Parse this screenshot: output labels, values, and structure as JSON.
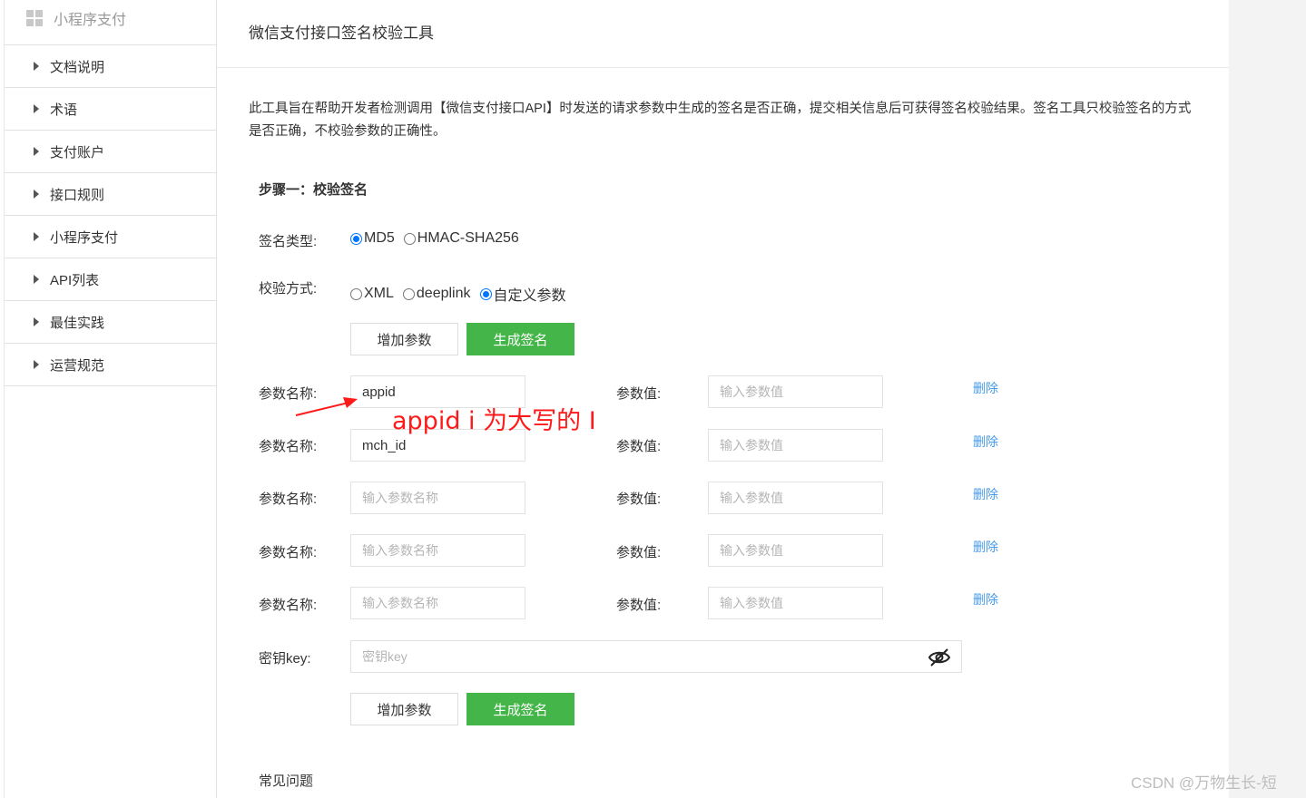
{
  "sidebar": {
    "header": "小程序支付",
    "items": [
      {
        "label": "文档说明"
      },
      {
        "label": "术语"
      },
      {
        "label": "支付账户"
      },
      {
        "label": "接口规则"
      },
      {
        "label": "小程序支付"
      },
      {
        "label": "API列表"
      },
      {
        "label": "最佳实践"
      },
      {
        "label": "运营规范"
      }
    ]
  },
  "main": {
    "title": "微信支付接口签名校验工具",
    "description": "此工具旨在帮助开发者检测调用【微信支付接口API】时发送的请求参数中生成的签名是否正确，提交相关信息后可获得签名校验结果。签名工具只校验签名的方式是否正确，不校验参数的正确性。",
    "step_title": "步骤一：校验签名",
    "sign_type": {
      "label": "签名类型:",
      "options": [
        "MD5",
        "HMAC-SHA256"
      ],
      "selected": "MD5"
    },
    "verify_method": {
      "label": "校验方式:",
      "options": [
        "XML",
        "deeplink",
        "自定义参数"
      ],
      "selected": "自定义参数"
    },
    "add_param_label": "增加参数",
    "generate_sign_label": "生成签名",
    "param_name_label": "参数名称:",
    "param_value_label": "参数值:",
    "delete_label": "删除",
    "name_placeholder": "输入参数名称",
    "value_placeholder": "输入参数值",
    "params": [
      {
        "name": "appid",
        "value": ""
      },
      {
        "name": "mch_id",
        "value": ""
      },
      {
        "name": "",
        "value": ""
      },
      {
        "name": "",
        "value": ""
      },
      {
        "name": "",
        "value": ""
      }
    ],
    "key_label": "密钥key:",
    "key_placeholder": "密钥key",
    "faq": "常见问题"
  },
  "annotation": {
    "text": "appid i 为大写的 I",
    "color": "#ff1a1a"
  },
  "watermark": "CSDN @万物生长-短",
  "colors": {
    "primary_green": "#44b549",
    "link_blue": "#459ae9",
    "radio_blue": "#0075ff"
  }
}
